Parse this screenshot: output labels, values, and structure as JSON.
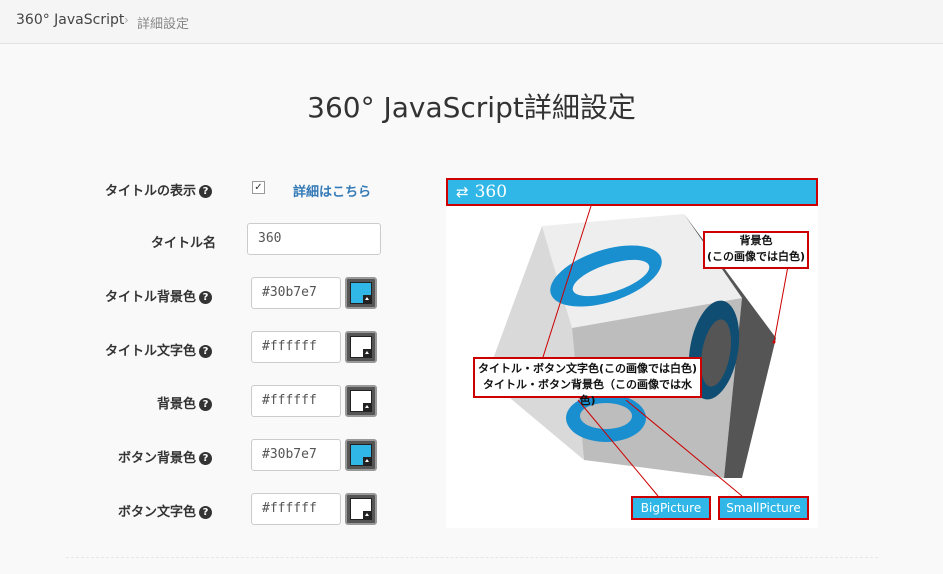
{
  "breadcrumb": {
    "home": "360° JavaScript",
    "separator": "›",
    "current": "詳細設定"
  },
  "page_title": "360° JavaScript詳細設定",
  "settings": {
    "show_title": {
      "label": "タイトルの表示",
      "checked": true,
      "link": "詳細はこちら"
    },
    "title_name": {
      "label": "タイトル名",
      "value": "360"
    },
    "title_bg": {
      "label": "タイトル背景色",
      "value": "#30b7e7"
    },
    "title_text": {
      "label": "タイトル文字色",
      "value": "#ffffff"
    },
    "bg": {
      "label": "背景色",
      "value": "#ffffff"
    },
    "button_bg": {
      "label": "ボタン背景色",
      "value": "#30b7e7"
    },
    "button_text": {
      "label": "ボタン文字色",
      "value": "#ffffff"
    }
  },
  "help_icon": "?",
  "preview": {
    "header_icon": "retweet-icon",
    "header_title": "360",
    "annotation_bg_line1": "背景色",
    "annotation_bg_line2": "(この画像では白色)",
    "annotation_btn_line1": "タイトル・ボタン文字色(この画像では白色)",
    "annotation_btn_line2": "タイトル・ボタン背景色（この画像では水色)",
    "big_button": "BigPicture",
    "small_button": "SmallPicture"
  },
  "colors": {
    "accent": "#30b7e7",
    "annotation_border": "#cc0000",
    "white": "#ffffff"
  }
}
